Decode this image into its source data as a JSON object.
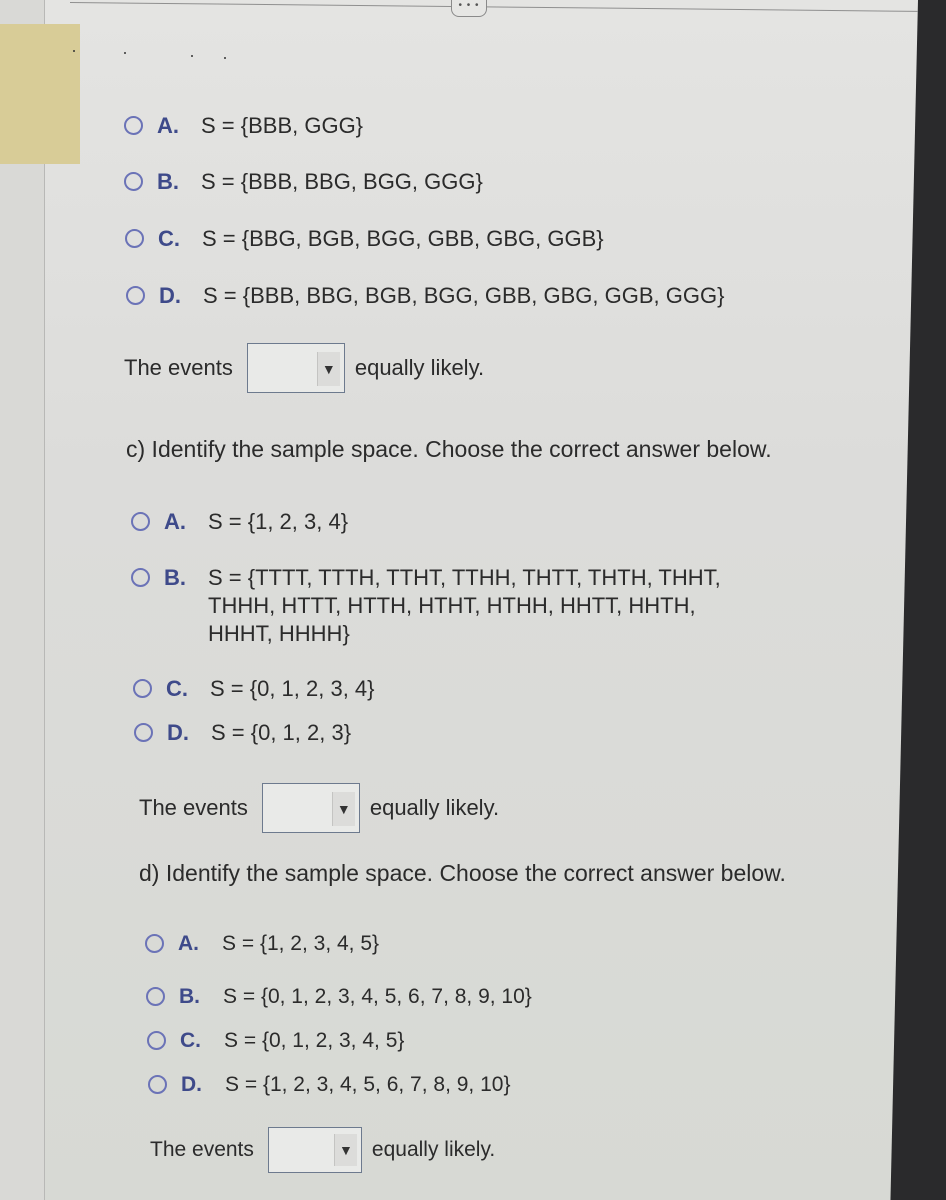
{
  "handle": {
    "label": "• • •"
  },
  "part_b": {
    "choices": [
      {
        "letter": "A.",
        "text": "S = {BBB, GGG}"
      },
      {
        "letter": "B.",
        "text": "S = {BBB, BBG, BGG, GGG}"
      },
      {
        "letter": "C.",
        "text": "S = {BBG, BGB, BGG, GBB, GBG, GGB}"
      },
      {
        "letter": "D.",
        "text": "S = {BBB, BBG, BGB, BGG, GBB, GBG, GGB, GGG}"
      }
    ],
    "events": {
      "prefix": "The events",
      "selected": "",
      "suffix": "equally likely."
    }
  },
  "part_c": {
    "question": "c) Identify the sample space. Choose the correct answer below.",
    "choices": [
      {
        "letter": "A.",
        "text": "S = {1, 2, 3, 4}"
      },
      {
        "letter": "B.",
        "text": "S = {TTTT, TTTH, TTHT, TTHH, THTT, THTH, THHT,\nTHHH, HTTT, HTTH, HTHT, HTHH, HHTT, HHTH,\nHHHT, HHHH}"
      },
      {
        "letter": "C.",
        "text": "S = {0, 1, 2, 3, 4}"
      },
      {
        "letter": "D.",
        "text": "S = {0, 1, 2, 3}"
      }
    ],
    "events": {
      "prefix": "The events",
      "selected": "",
      "suffix": "equally likely."
    }
  },
  "part_d": {
    "question": "d) Identify the sample space. Choose the correct answer below.",
    "choices": [
      {
        "letter": "A.",
        "text": "S = {1, 2, 3, 4, 5}"
      },
      {
        "letter": "B.",
        "text": "S = {0, 1, 2, 3, 4, 5, 6, 7, 8, 9, 10}"
      },
      {
        "letter": "C.",
        "text": "S = {0, 1, 2, 3, 4, 5}"
      },
      {
        "letter": "D.",
        "text": "S = {1, 2, 3, 4, 5, 6, 7, 8, 9, 10}"
      }
    ],
    "events": {
      "prefix": "The events",
      "selected": "",
      "suffix": "equally likely."
    }
  }
}
